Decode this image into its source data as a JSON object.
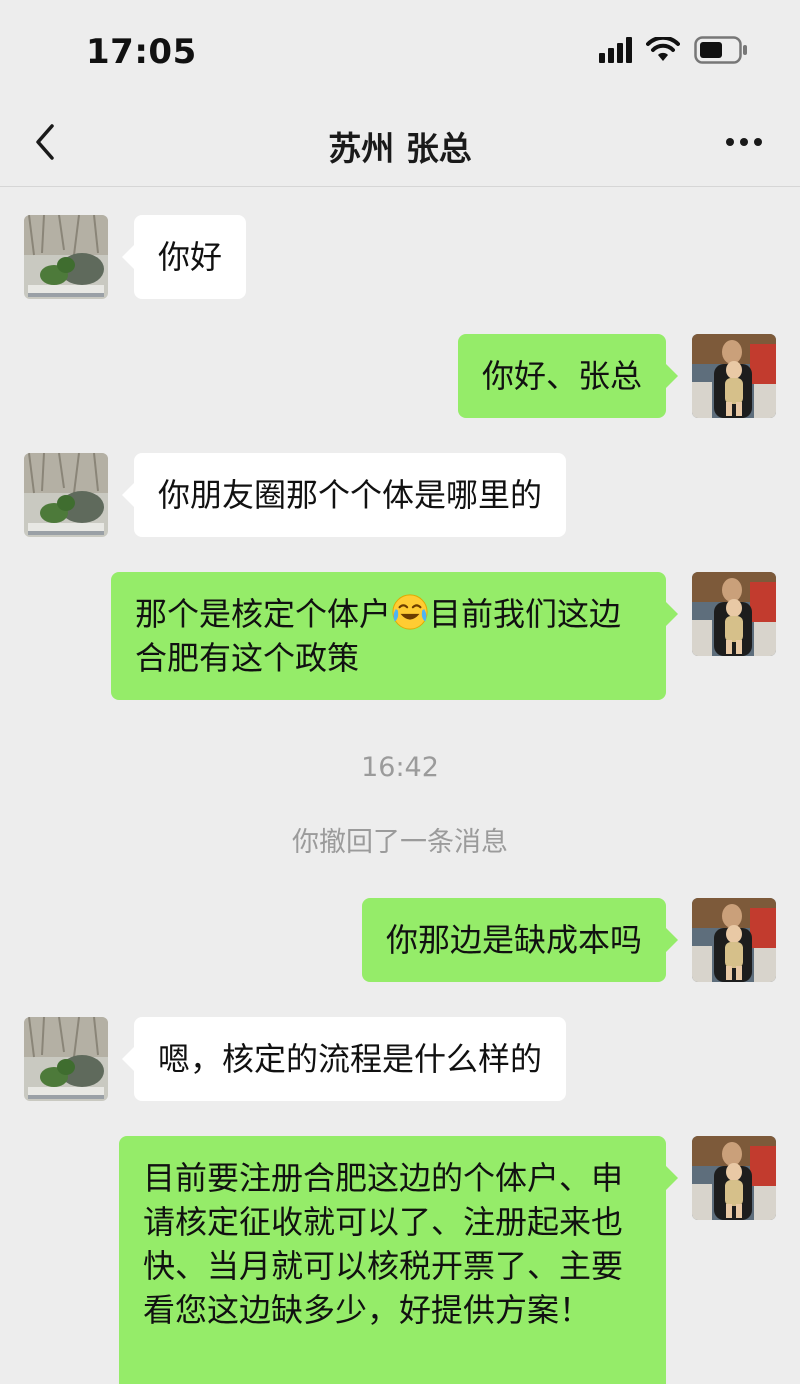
{
  "status": {
    "time": "17:05"
  },
  "header": {
    "title": "苏州 张总"
  },
  "messages": [
    {
      "side": "left",
      "text": "你好"
    },
    {
      "side": "right",
      "text": "你好、张总"
    },
    {
      "side": "left",
      "text": "你朋友圈那个个体是哪里的"
    },
    {
      "side": "right",
      "text_before": "那个是核定个体户",
      "emoji": "crying-laughing-emoji",
      "text_after": "目前我们这边合肥有这个政策"
    },
    {
      "side": "right",
      "text": "你那边是缺成本吗"
    },
    {
      "side": "left",
      "text": "嗯，核定的流程是什么样的"
    },
    {
      "side": "right",
      "text": "目前要注册合肥这边的个体户、申请核定征收就可以了、注册起来也快、当月就可以核税开票了、主要看您这边缺多少，好提供方案！"
    }
  ],
  "timestamp": "16:42",
  "recall_notice": "你撤回了一条消息",
  "colors": {
    "background": "#ededed",
    "bubble_self": "#95ec69",
    "bubble_other": "#ffffff"
  },
  "icons": {
    "back": "chevron-left-icon",
    "more": "more-dots-icon",
    "signal": "cellular-signal-icon",
    "wifi": "wifi-icon",
    "battery": "battery-icon"
  }
}
